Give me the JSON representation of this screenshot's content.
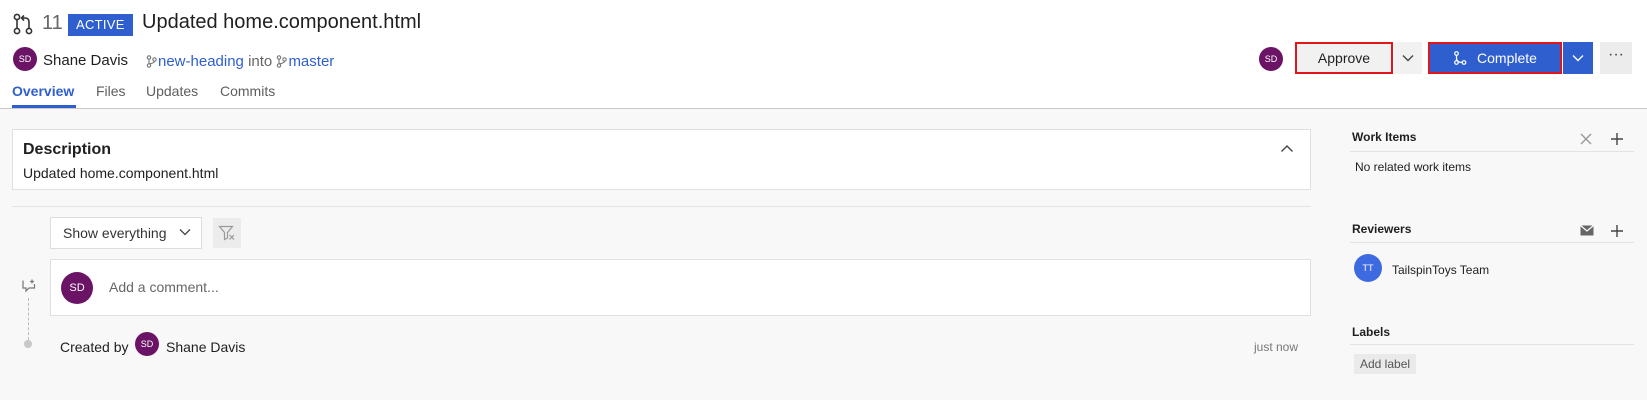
{
  "header": {
    "pr_number": "11",
    "status_badge": "ACTIVE",
    "title": "Updated home.component.html",
    "author": {
      "initials": "SD",
      "name": "Shane Davis"
    },
    "source_branch": "new-heading",
    "into_word": "into",
    "target_branch": "master"
  },
  "tabs": [
    {
      "label": "Overview",
      "active": true
    },
    {
      "label": "Files",
      "active": false
    },
    {
      "label": "Updates",
      "active": false
    },
    {
      "label": "Commits",
      "active": false
    }
  ],
  "actions": {
    "reviewer_initials": "SD",
    "approve_label": "Approve",
    "complete_label": "Complete",
    "more_label": "···"
  },
  "description": {
    "heading": "Description",
    "text": "Updated home.component.html"
  },
  "activity": {
    "filter_value": "Show everything",
    "comment_avatar_initials": "SD",
    "comment_placeholder": "Add a comment...",
    "created_by_label": "Created by",
    "created_by_initials": "SD",
    "created_by_name": "Shane Davis",
    "created_time": "just now"
  },
  "sidebar": {
    "work_items": {
      "title": "Work Items",
      "empty_text": "No related work items"
    },
    "reviewers": {
      "title": "Reviewers",
      "items": [
        {
          "initials": "TT",
          "name": "TailspinToys Team"
        }
      ]
    },
    "labels": {
      "title": "Labels",
      "add_label": "Add label"
    }
  },
  "colors": {
    "accent": "#2f5fcf",
    "highlight_border": "#e0161b",
    "avatar_purple": "#6b1466",
    "team_avatar_blue": "#3e6ae1"
  },
  "icons": [
    "pull-request-icon",
    "branch-icon",
    "chevron-down-icon",
    "chevron-up-icon",
    "filter-clear-icon",
    "add-comment-icon",
    "close-icon",
    "plus-icon",
    "mail-icon",
    "complete-icon"
  ]
}
